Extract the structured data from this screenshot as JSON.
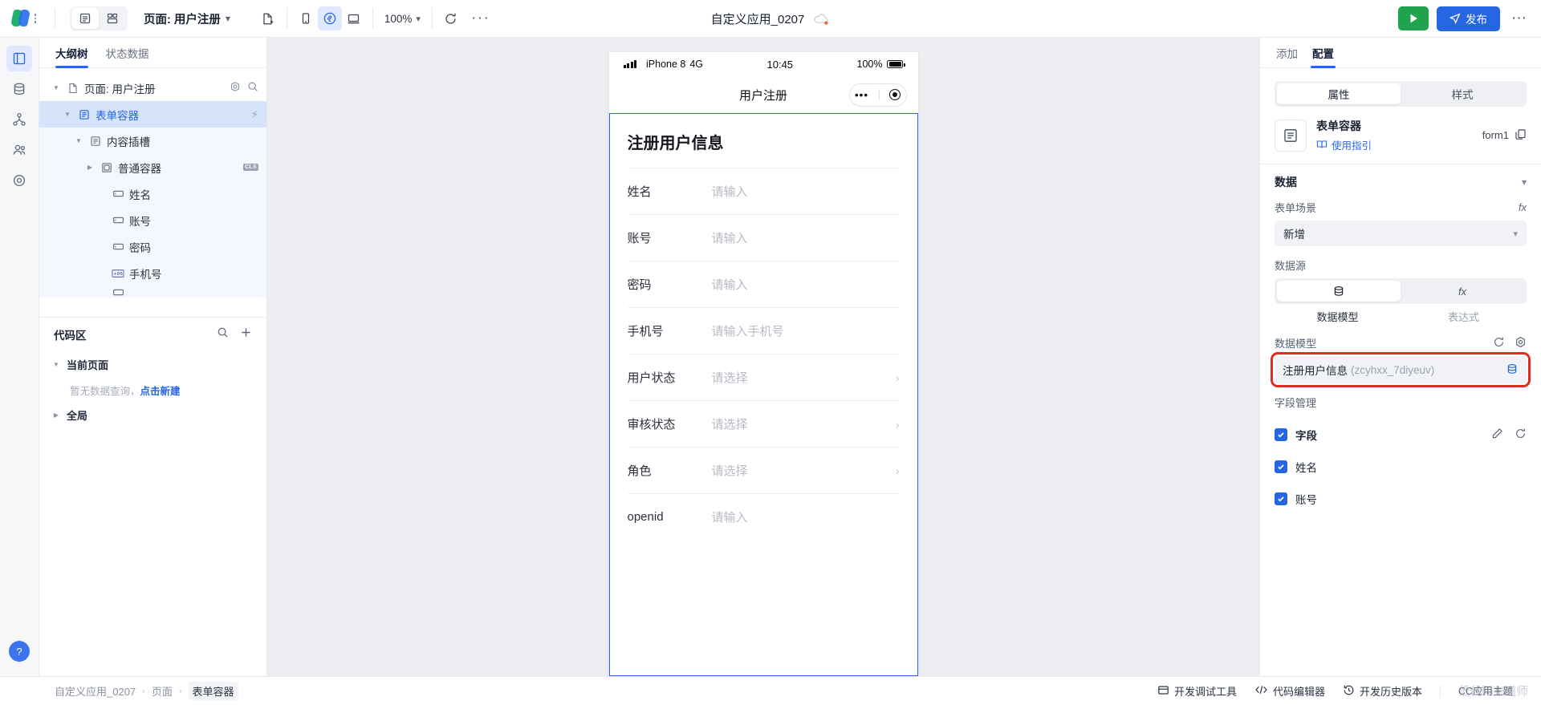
{
  "topbar": {
    "page_selector_label": "页面: 用户注册",
    "zoom_level": "100%",
    "app_title": "自定义应用_0207",
    "run_label": "",
    "publish_label": "发布",
    "more_label": "···",
    "center_dots": "···"
  },
  "left_panel": {
    "tabs": [
      {
        "label": "大纲树",
        "active": true
      },
      {
        "label": "状态数据",
        "active": false
      }
    ],
    "tree": [
      {
        "label": "页面: 用户注册",
        "icon": "file-icon",
        "indent": 0,
        "caret": "down",
        "state": "normal",
        "tail": "gear"
      },
      {
        "label": "表单容器",
        "icon": "form-icon",
        "indent": 1,
        "caret": "down",
        "state": "selected",
        "tail": "bolt"
      },
      {
        "label": "内容插槽",
        "icon": "slot-icon",
        "indent": 2,
        "caret": "down",
        "state": "hl",
        "tail": ""
      },
      {
        "label": "普通容器",
        "icon": "container-icon",
        "indent": 3,
        "caret": "right",
        "state": "hl",
        "tail": "cls"
      },
      {
        "label": "姓名",
        "icon": "input-icon",
        "indent": 3,
        "caret": "none",
        "state": "hl",
        "tail": ""
      },
      {
        "label": "账号",
        "icon": "input-icon",
        "indent": 3,
        "caret": "none",
        "state": "hl",
        "tail": ""
      },
      {
        "label": "密码",
        "icon": "input-icon",
        "indent": 3,
        "caret": "none",
        "state": "hl",
        "tail": ""
      },
      {
        "label": "手机号",
        "icon": "phone-86-icon",
        "indent": 3,
        "caret": "none",
        "state": "hl",
        "tail": ""
      }
    ],
    "code_area": {
      "title": "代码区",
      "current_page_label": "当前页面",
      "empty_text": "暂无数据查询，",
      "empty_link": "点击新建",
      "global_label": "全局"
    }
  },
  "canvas": {
    "phone": {
      "status": {
        "carrier": "iPhone 8",
        "network": "4G",
        "time": "10:45",
        "battery_pct": "100%"
      },
      "nav_title": "用户注册",
      "form_title": "注册用户信息",
      "fields": [
        {
          "label": "姓名",
          "value": "请输入",
          "type": "input"
        },
        {
          "label": "账号",
          "value": "请输入",
          "type": "input"
        },
        {
          "label": "密码",
          "value": "请输入",
          "type": "input"
        },
        {
          "label": "手机号",
          "value": "请输入手机号",
          "type": "input"
        },
        {
          "label": "用户状态",
          "value": "请选择",
          "type": "select"
        },
        {
          "label": "审核状态",
          "value": "请选择",
          "type": "select"
        },
        {
          "label": "角色",
          "value": "请选择",
          "type": "select"
        },
        {
          "label": "openid",
          "value": "请输入",
          "type": "input"
        }
      ]
    }
  },
  "right_panel": {
    "tabs": [
      {
        "label": "添加",
        "active": false
      },
      {
        "label": "配置",
        "active": true
      }
    ],
    "prop_style_seg": [
      {
        "label": "属性",
        "active": true
      },
      {
        "label": "样式",
        "active": false
      }
    ],
    "component": {
      "name": "表单容器",
      "guide_label": "使用指引",
      "id": "form1"
    },
    "data_section": {
      "title": "数据",
      "scene_label": "表单场景",
      "scene_value": "新增",
      "source_label": "数据源",
      "source_tabs": [
        {
          "label": "数据模型",
          "active": true
        },
        {
          "label": "表达式",
          "active": false
        }
      ],
      "model_label": "数据模型",
      "model_value": "注册用户信息",
      "model_id": "(zcyhxx_7diyeuv)",
      "field_mgmt_label": "字段管理",
      "fields": [
        {
          "label": "字段",
          "checked": true,
          "header": true
        },
        {
          "label": "姓名",
          "checked": true,
          "header": false
        },
        {
          "label": "账号",
          "checked": true,
          "header": false
        }
      ]
    }
  },
  "statusbar": {
    "breadcrumbs": [
      "自定义应用_0207",
      "页面",
      "表单容器"
    ],
    "items": [
      {
        "label": "开发调试工具",
        "icon": "debug-icon"
      },
      {
        "label": "代码编辑器",
        "icon": "code-icon"
      },
      {
        "label": "开发历史版本",
        "icon": "history-icon"
      }
    ],
    "watermark": "低代码布道师",
    "watermark_overlay": "CC应用主题"
  },
  "colors": {
    "accent": "#2766e3",
    "run_green": "#21a24c",
    "highlight_red": "#e02b20"
  }
}
